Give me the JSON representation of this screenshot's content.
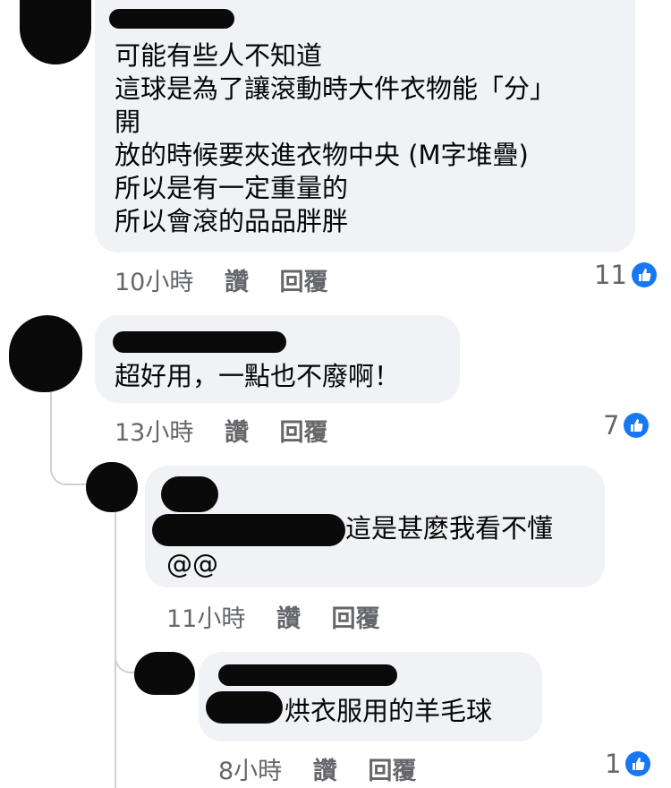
{
  "comments": [
    {
      "lines": [
        "可能有些人不知道",
        "這球是為了讓滾動時大件衣物能「分」",
        "開",
        "放的時候要夾進衣物中央 (M字堆疊)",
        "所以是有一定重量的",
        "所以會滾的品品胖胖"
      ],
      "time": "10小時",
      "like_label": "讚",
      "reply_label": "回覆",
      "likes": "11"
    },
    {
      "lines": [
        "超好用，一點也不廢啊！"
      ],
      "time": "13小時",
      "like_label": "讚",
      "reply_label": "回覆",
      "likes": "7"
    },
    {
      "lines": [
        "這是甚麼我看不懂",
        "@@"
      ],
      "time": "11小時",
      "like_label": "讚",
      "reply_label": "回覆"
    },
    {
      "lines": [
        "烘衣服用的羊毛球"
      ],
      "time": "8小時",
      "like_label": "讚",
      "reply_label": "回覆",
      "likes": "1"
    }
  ],
  "colors": {
    "bubble": "#f0f2f5",
    "meta": "#65676b",
    "like_badge": "#1877f2",
    "redaction": "#0a0a0a"
  },
  "icons": {
    "like_badge": "thumbs-up-icon"
  }
}
